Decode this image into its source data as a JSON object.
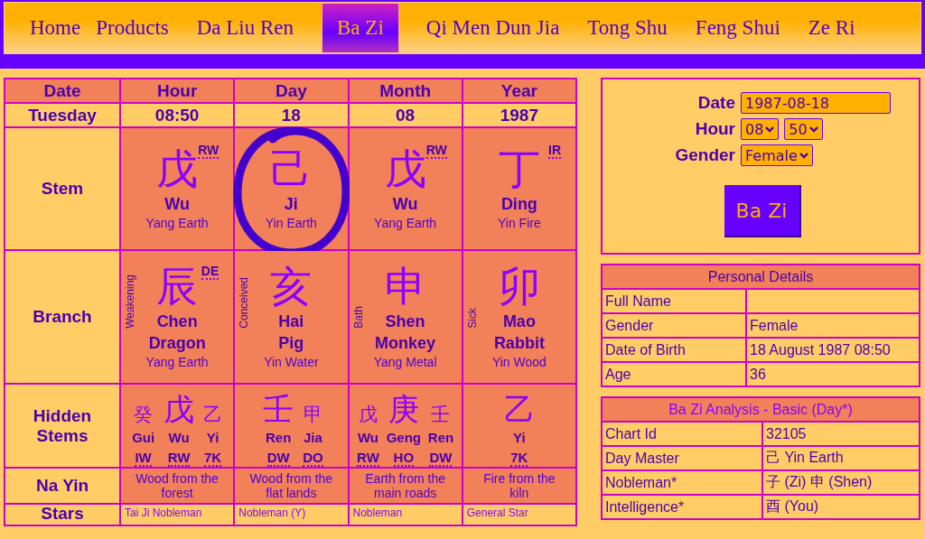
{
  "nav": [
    {
      "label": "Home",
      "selected": false
    },
    {
      "label": "Products",
      "selected": false
    },
    {
      "label": "Da Liu Ren",
      "selected": false
    },
    {
      "label": "Ba Zi",
      "selected": true
    },
    {
      "label": "Qi Men Dun Jia",
      "selected": false
    },
    {
      "label": "Tong Shu",
      "selected": false
    },
    {
      "label": "Feng Shui",
      "selected": false
    },
    {
      "label": "Ze Ri",
      "selected": false
    }
  ],
  "chart": {
    "headers": [
      "Date",
      "Hour",
      "Day",
      "Month",
      "Year"
    ],
    "date_row": [
      "Tuesday",
      "08:50",
      "18",
      "08",
      "1987"
    ],
    "stem": {
      "label": "Stem",
      "cells": [
        {
          "char": "戊",
          "tag": "RW",
          "name": "Wu",
          "element": "Yang Earth",
          "circled": false
        },
        {
          "char": "己",
          "name": "Ji",
          "element": "Yin Earth",
          "circled": true
        },
        {
          "char": "戊",
          "tag": "RW",
          "name": "Wu",
          "element": "Yang Earth",
          "circled": false
        },
        {
          "char": "丁",
          "tag": "IR",
          "name": "Ding",
          "element": "Yin Fire",
          "circled": false
        }
      ]
    },
    "branch": {
      "label": "Branch",
      "cells": [
        {
          "stage": "Weakening",
          "char": "辰",
          "tag": "DE",
          "name": "Chen",
          "animal": "Dragon",
          "element": "Yang Earth"
        },
        {
          "stage": "Conceived",
          "char": "亥",
          "name": "Hai",
          "animal": "Pig",
          "element": "Yin Water"
        },
        {
          "stage": "Bath",
          "char": "申",
          "name": "Shen",
          "animal": "Monkey",
          "element": "Yang Metal"
        },
        {
          "stage": "Sick",
          "char": "卯",
          "name": "Mao",
          "animal": "Rabbit",
          "element": "Yin Wood"
        }
      ]
    },
    "hidden": {
      "label": "Hidden Stems",
      "cells": [
        {
          "stems": [
            {
              "char": "癸",
              "name": "Gui",
              "tag": "IW",
              "main": false
            },
            {
              "char": "戊",
              "name": "Wu",
              "tag": "RW",
              "main": true
            },
            {
              "char": "乙",
              "name": "Yi",
              "tag": "7K",
              "main": false
            }
          ]
        },
        {
          "stems": [
            {
              "char": "壬",
              "name": "Ren",
              "tag": "DW",
              "main": true
            },
            {
              "char": "甲",
              "name": "Jia",
              "tag": "DO",
              "main": false
            }
          ]
        },
        {
          "stems": [
            {
              "char": "戊",
              "name": "Wu",
              "tag": "RW",
              "main": false
            },
            {
              "char": "庚",
              "name": "Geng",
              "tag": "HO",
              "main": true
            },
            {
              "char": "壬",
              "name": "Ren",
              "tag": "DW",
              "main": false
            }
          ]
        },
        {
          "stems": [
            {
              "char": "乙",
              "name": "Yi",
              "tag": "7K",
              "main": true
            }
          ]
        }
      ]
    },
    "na_yin": {
      "label": "Na Yin",
      "cells": [
        "Wood from the forest",
        "Wood from the flat lands",
        "Earth from the main roads",
        "Fire from the kiln"
      ]
    },
    "stars": {
      "label": "Stars",
      "cells": [
        "Tai Ji Nobleman",
        "Nobleman (Y)",
        "Nobleman",
        "General Star"
      ]
    }
  },
  "form": {
    "date_label": "Date",
    "date_value": "1987-08-18",
    "hour_label": "Hour",
    "hour_value": "08",
    "minute_value": "50",
    "gender_label": "Gender",
    "gender_value": "Female",
    "submit": "Ba Zi"
  },
  "personal_details": {
    "title": "Personal Details",
    "rows": [
      {
        "label": "Full Name"
      },
      {
        "label": "Gender",
        "value": "Female"
      },
      {
        "label": "Date of Birth",
        "value": "18 August 1987 08:50"
      },
      {
        "label": "Age",
        "value": "36"
      }
    ]
  },
  "analysis": {
    "title": "Ba Zi Analysis - Basic (Day*)",
    "rows": [
      {
        "label": "Chart Id",
        "value": "32105"
      },
      {
        "label": "Day Master",
        "value": "己 Yin Earth"
      },
      {
        "label": "Nobleman*",
        "value": "子 (Zi) 申 (Shen)"
      },
      {
        "label": "Intelligence*",
        "value": "酉 (You)"
      }
    ]
  }
}
